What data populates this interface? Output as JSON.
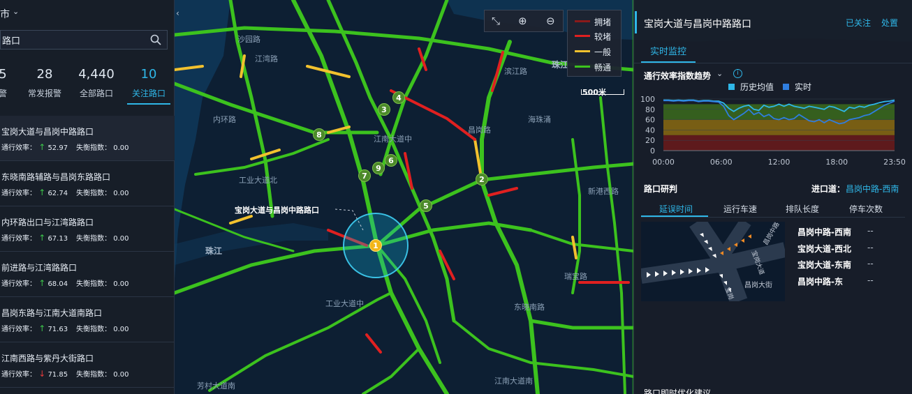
{
  "left_panel": {
    "city": "市",
    "search_value": "路口",
    "stats": [
      {
        "num": "5",
        "label": "警"
      },
      {
        "num": "28",
        "label": "常发报警"
      },
      {
        "num": "4,440",
        "label": "全部路口"
      },
      {
        "num": "10",
        "label": "关注路口"
      }
    ],
    "eff_label": "通行效率：",
    "imb_label": "失衡指数：",
    "items": [
      {
        "name": "宝岗大道与昌岗中路路口",
        "eff": "52.97",
        "imb": "0.00",
        "trend": "up"
      },
      {
        "name": "东晓南路辅路与昌岗东路路口",
        "eff": "62.74",
        "imb": "0.00",
        "trend": "up"
      },
      {
        "name": "内环路出口与江湾路路口",
        "eff": "67.13",
        "imb": "0.00",
        "trend": "up"
      },
      {
        "name": "前进路与江湾路路口",
        "eff": "68.04",
        "imb": "0.00",
        "trend": "up"
      },
      {
        "name": "昌岗东路与江南大道南路口",
        "eff": "71.63",
        "imb": "0.00",
        "trend": "up"
      },
      {
        "name": "江南西路与紫丹大街路口",
        "eff": "71.85",
        "imb": "0.00",
        "trend": "down"
      }
    ]
  },
  "map": {
    "legend": [
      {
        "label": "拥堵",
        "color": "#8b1a1a"
      },
      {
        "label": "较堵",
        "color": "#e02020"
      },
      {
        "label": "一般",
        "color": "#f2c12e"
      },
      {
        "label": "畅通",
        "color": "#3cc21e"
      }
    ],
    "scale": "500米",
    "callout": "宝岗大道与昌岗中路路口",
    "markers": [
      "1",
      "2",
      "3",
      "4",
      "5",
      "6",
      "7",
      "8",
      "9"
    ],
    "labels": {
      "pearl1": "珠江",
      "pearl2": "珠江",
      "haizhuyong": "海珠涌",
      "jiangnan": "江南大道中",
      "gongye_n": "工业大道北",
      "gongye_z": "工业大道中",
      "neihuan": "内环路",
      "changgang": "昌岗路",
      "dongxiao": "东晓南路",
      "fangcun": "芳村大道南",
      "jiangnan2": "江南大道南",
      "ruibao": "瑞宝路",
      "binjiang": "滨江路",
      "jiangwan": "江湾路",
      "xingang": "新港西路",
      "shanggang": "沙园路"
    }
  },
  "right_panel": {
    "title": "宝岗大道与昌岗中路路口",
    "follow": "已关注",
    "handle": "处置",
    "tab": "实时监控",
    "trend_title": "通行效率指数趋势",
    "legend_hist": "历史均值",
    "legend_live": "实时",
    "section2": "路口研判",
    "entry_label": "进口道：",
    "entry_value": "昌岗中路-西南",
    "subtabs": [
      "延误时间",
      "运行车速",
      "排队长度",
      "停车次数"
    ],
    "junction_labels": {
      "road1": "昌岗中路",
      "road2": "宝岗大道",
      "road3": "昌岗大街",
      "road4": "宝岗"
    },
    "directions": [
      {
        "name": "昌岗中路-西南",
        "value": "--"
      },
      {
        "name": "宝岗大道-西北",
        "value": "--"
      },
      {
        "name": "宝岗大道-东南",
        "value": "--"
      },
      {
        "name": "昌岗中路-东",
        "value": "--"
      }
    ],
    "bottom_text": "路口即时优化建议"
  },
  "chart_data": {
    "type": "line",
    "x_ticks": [
      "00:00",
      "06:00",
      "12:00",
      "18:00",
      "23:50"
    ],
    "y_ticks": [
      0,
      20,
      40,
      60,
      80,
      100
    ],
    "ylim": [
      0,
      100
    ],
    "bands": [
      {
        "from": 0,
        "to": 30,
        "color": "#6b1a1a"
      },
      {
        "from": 30,
        "to": 60,
        "color": "#8a6a10"
      },
      {
        "from": 60,
        "to": 90,
        "color": "#3b6b1c"
      }
    ],
    "series": [
      {
        "name": "历史均值",
        "color": "#2fb7e8",
        "values": [
          98,
          98,
          97,
          98,
          97,
          98,
          98,
          96,
          97,
          97,
          96,
          96,
          92,
          82,
          76,
          82,
          86,
          88,
          80,
          78,
          88,
          84,
          86,
          90,
          86,
          90,
          86,
          84,
          82,
          86,
          84,
          82,
          80,
          86,
          84,
          80,
          76,
          84,
          82,
          86,
          84,
          88,
          90,
          93,
          95,
          96,
          98
        ]
      },
      {
        "name": "实时",
        "color": "#2f7ee0",
        "values": [
          97,
          97,
          96,
          97,
          96,
          97,
          97,
          95,
          96,
          96,
          95,
          94,
          86,
          68,
          60,
          66,
          72,
          80,
          70,
          74,
          66,
          70,
          62,
          60,
          64,
          60,
          62,
          70,
          64,
          58,
          56,
          60,
          54,
          60,
          56,
          52,
          54,
          60,
          62,
          64,
          68,
          70,
          76,
          82,
          88,
          92,
          96
        ]
      }
    ]
  }
}
